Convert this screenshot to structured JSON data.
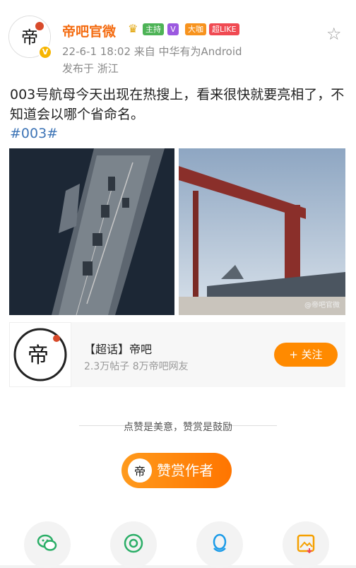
{
  "header": {
    "name": "帝吧官微",
    "tags": {
      "host": "主持",
      "vip": "V",
      "fan": "大咖",
      "like": "超LIKE"
    },
    "meta": "22-6-1 18:02 来自 中华有为Android",
    "location": "发布于 浙江"
  },
  "post": {
    "text": "003号航母今天出现在热搜上，看来很快就要亮相了，不知道会以哪个省命名。",
    "hashtag": "#003#"
  },
  "images": {
    "watermark": "@帝吧官微"
  },
  "topic": {
    "title": "【超话】帝吧",
    "subtitle": "2.3万帖子 8万帝吧网友",
    "follow_label": "+ 关注"
  },
  "reward": {
    "tip": "点赞是美意，赞赏是鼓励",
    "button_label": "赞赏作者"
  },
  "share_icons": [
    "wechat-icon",
    "moments-icon",
    "qq-icon",
    "save-image-icon"
  ],
  "colors": {
    "name": "#f46b10",
    "hashtag": "#3d74b6",
    "accent": "#ff8a00"
  }
}
